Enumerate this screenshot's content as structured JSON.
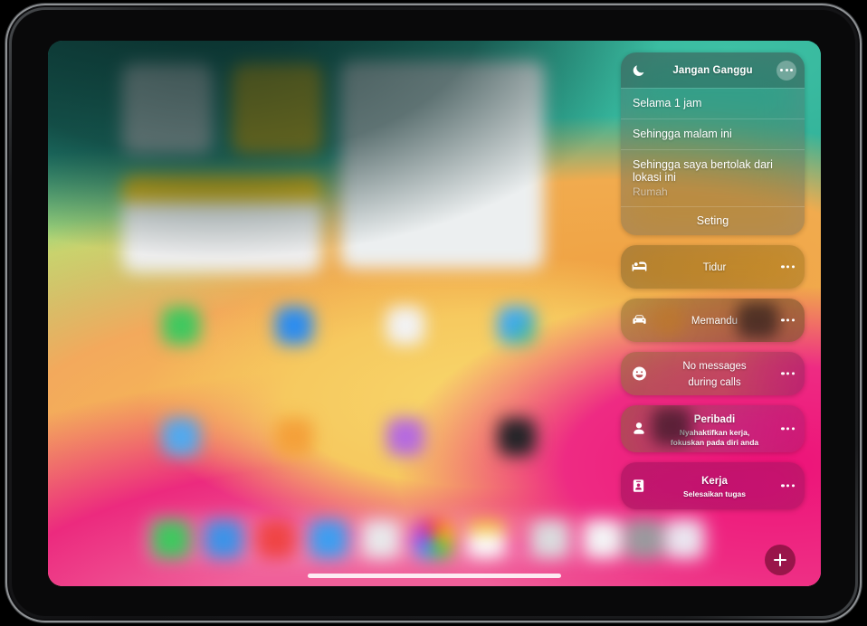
{
  "device": {
    "kind": "tablet",
    "orientation": "landscape"
  },
  "focus_panel": {
    "dnd": {
      "icon": "moon-icon",
      "title": "Jangan Ganggu",
      "more_icon": "ellipsis-icon",
      "options": [
        {
          "label": "Selama 1 jam",
          "sub": ""
        },
        {
          "label": "Sehingga malam ini",
          "sub": ""
        },
        {
          "label": "Sehingga saya bertolak dari lokasi ini",
          "sub": "Rumah"
        }
      ],
      "settings_label": "Seting"
    },
    "modes": [
      {
        "icon": "bed-icon",
        "name": "Tidur",
        "desc": "",
        "more_icon": "ellipsis-icon",
        "tint": "t-sleep"
      },
      {
        "icon": "car-icon",
        "name": "Memandu",
        "desc": "",
        "more_icon": "ellipsis-icon",
        "tint": "t-drive"
      },
      {
        "icon": "smiley-icon",
        "name": "No messages\nduring calls",
        "desc": "",
        "more_icon": "ellipsis-icon",
        "tint": "t-nomsg"
      },
      {
        "icon": "person-icon",
        "name": "Peribadi",
        "desc": "Nyahaktifkan kerja,\nfokuskan pada diri anda",
        "more_icon": "ellipsis-icon",
        "tint": "t-personal"
      },
      {
        "icon": "badge-icon",
        "name": "Kerja",
        "desc": "Selesaikan tugas",
        "more_icon": "ellipsis-icon",
        "tint": "t-work"
      }
    ]
  },
  "bottom_bar": {
    "add_button_icon": "plus-icon",
    "home_indicator": "home-indicator"
  },
  "colors": {
    "wallpaper_teal": "#33b39a",
    "wallpaper_green": "#92dc86",
    "wallpaper_orange": "#f0a243",
    "wallpaper_yellow": "#f6c95f",
    "wallpaper_magenta": "#ed1278",
    "wallpaper_pink": "#f0609a",
    "panel_text": "#ffffff",
    "add_button_bg": "#780e34"
  }
}
